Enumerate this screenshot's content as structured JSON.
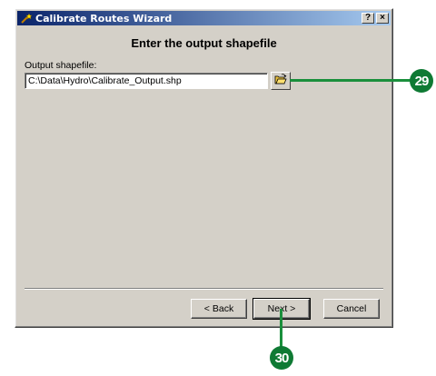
{
  "window": {
    "title": "Calibrate Routes Wizard",
    "help_btn": "?",
    "close_btn": "×"
  },
  "page": {
    "heading": "Enter the output shapefile",
    "field_label": "Output shapefile:",
    "field_value": "C:\\Data\\Hydro\\Calibrate_Output.shp"
  },
  "buttons": {
    "back": "< Back",
    "next": "Next >",
    "cancel": "Cancel"
  },
  "callouts": {
    "browse": "29",
    "next": "30"
  },
  "colors": {
    "callout": "#0f7a34",
    "titlebar_start": "#0a246a",
    "titlebar_end": "#a6caf0"
  }
}
